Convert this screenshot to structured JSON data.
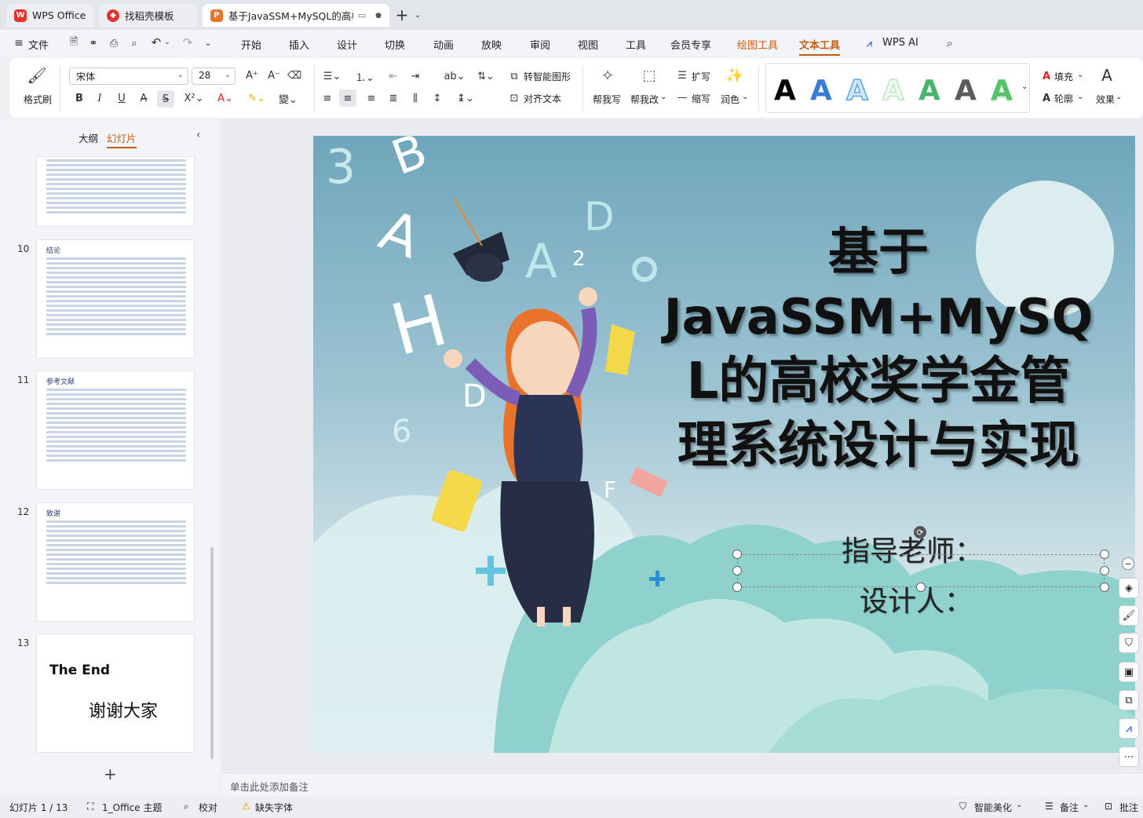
{
  "tabs": [
    {
      "label": "WPS Office",
      "icon": "wps-logo-icon"
    },
    {
      "label": "找稻壳模板",
      "icon": "docer-logo-icon"
    },
    {
      "label": "基于JavaSSM+MySQL的高校",
      "icon": "presentation-logo-icon"
    }
  ],
  "menu": {
    "file": "文件",
    "items": [
      "开始",
      "插入",
      "设计",
      "切换",
      "动画",
      "放映",
      "审阅",
      "视图",
      "工具",
      "会员专享",
      "绘图工具",
      "文本工具",
      "WPS AI"
    ]
  },
  "ribbon": {
    "format_painter": "格式刷",
    "font_name": "宋体",
    "font_size": "28",
    "smart_shape": "转智能图形",
    "text_align": "对齐文本",
    "help_write": "帮我写",
    "help_edit": "帮我改",
    "expand": "扩写",
    "shrink": "缩写",
    "polish": "润色",
    "wordart_letter": "A",
    "fill": "填充",
    "outline": "轮廓",
    "effect": "效果"
  },
  "left_pane": {
    "tab_outline": "大纲",
    "tab_slides": "幻灯片",
    "slides": [
      {
        "num": "10",
        "title": "结论"
      },
      {
        "num": "11",
        "title": "参考文献"
      },
      {
        "num": "12",
        "title": "致谢"
      },
      {
        "num": "13",
        "title": "The End",
        "subtitle": "谢谢大家"
      }
    ],
    "add": "+"
  },
  "slide": {
    "title_line1": "基于",
    "title_line2": "JavaSSM+MySQ",
    "title_line3": "L的高校奖学金管",
    "title_line4": "理系统设计与实现",
    "advisor": "指导老师：",
    "designer": "设计人："
  },
  "notes_placeholder": "单击此处添加备注",
  "status": {
    "slide_counter": "幻灯片 1 / 13",
    "theme": "1_Office 主题",
    "proofread": "校对",
    "missing_font": "缺失字体",
    "beautify": "智能美化",
    "notes": "备注",
    "comments": "批注"
  },
  "colors": {
    "accent": "#c75d14",
    "wordart": [
      "#000000",
      "#3b7bd8",
      "#5aa5e8",
      "#bfe6c0",
      "#48b36a",
      "#5b5b5b",
      "#55c26a"
    ]
  }
}
